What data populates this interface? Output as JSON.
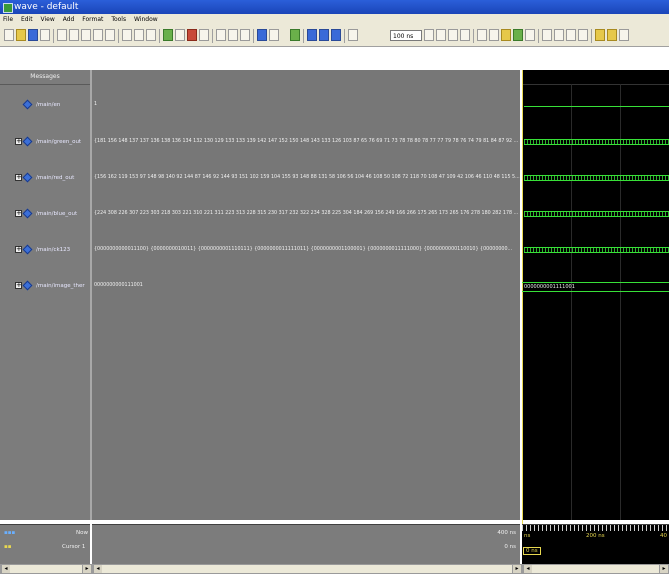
{
  "window": {
    "title": "wave - default"
  },
  "menu": [
    "File",
    "Edit",
    "View",
    "Add",
    "Format",
    "Tools",
    "Window"
  ],
  "toolbar": {
    "time_value": "100 ns"
  },
  "panes": {
    "messages_header": "Messages"
  },
  "signals": [
    {
      "name": "/main/en",
      "expandable": false,
      "values": "1",
      "display": "line-low"
    },
    {
      "name": "/main/green_out",
      "expandable": true,
      "values": "{181 156 148 137 137 136 138 136 134 132 130 129 133 133 139 142 147 152 150 148 143 133 126 103 87 65 76 69 71 73 78 78 80 78 77 77 79 78 76 74 79 81 84 87 92 ...",
      "display": "bus"
    },
    {
      "name": "/main/red_out",
      "expandable": true,
      "values": "{156 162 119 153 97 148 98 140 92 144 87 146 92 144 93 151 102 159 104 155 93 148 88 131 58 106 56 104 46 108 50 108 72 118 70 108 47 109 42 106 46 110 48 115 5...",
      "display": "bus"
    },
    {
      "name": "/main/blue_out",
      "expandable": true,
      "values": "{224 308 226 307 223 303 218 303 221 310 221 311 223 313 228 315 230 317 232 322 234 328 225 304 184 269 156 249 166 266 175 265 173 265 176 278 180 282 178 ...",
      "display": "bus"
    },
    {
      "name": "/main/ck123",
      "expandable": true,
      "values": "{0000000000011100} {0000000010011} {0000000001110111} {0000000011111011} {0000000001100001} {0000000011111000} {0000000000110010} {00000000...",
      "display": "bus"
    },
    {
      "name": "/main/image_ther",
      "expandable": true,
      "values": "0000000000111001",
      "display": "bus-value",
      "wave_value": "0000000001111001"
    }
  ],
  "cursor_panel": {
    "now_label": "Now",
    "now_value": "400 ns",
    "cursor_label": "Cursor 1",
    "cursor_value": "0 ns",
    "ruler_start": "ns",
    "ruler_mid": "200 ns",
    "ruler_end": "40",
    "cursor_badge": "0 ns"
  },
  "colors": {
    "wave_bg": "#000000",
    "signal_green": "#38e038",
    "pane_gray": "#7c7c7c",
    "cursor_yellow": "#e8d850"
  },
  "icons": [
    "app-icon",
    "plus-icon",
    "signal-diamond-icon"
  ]
}
